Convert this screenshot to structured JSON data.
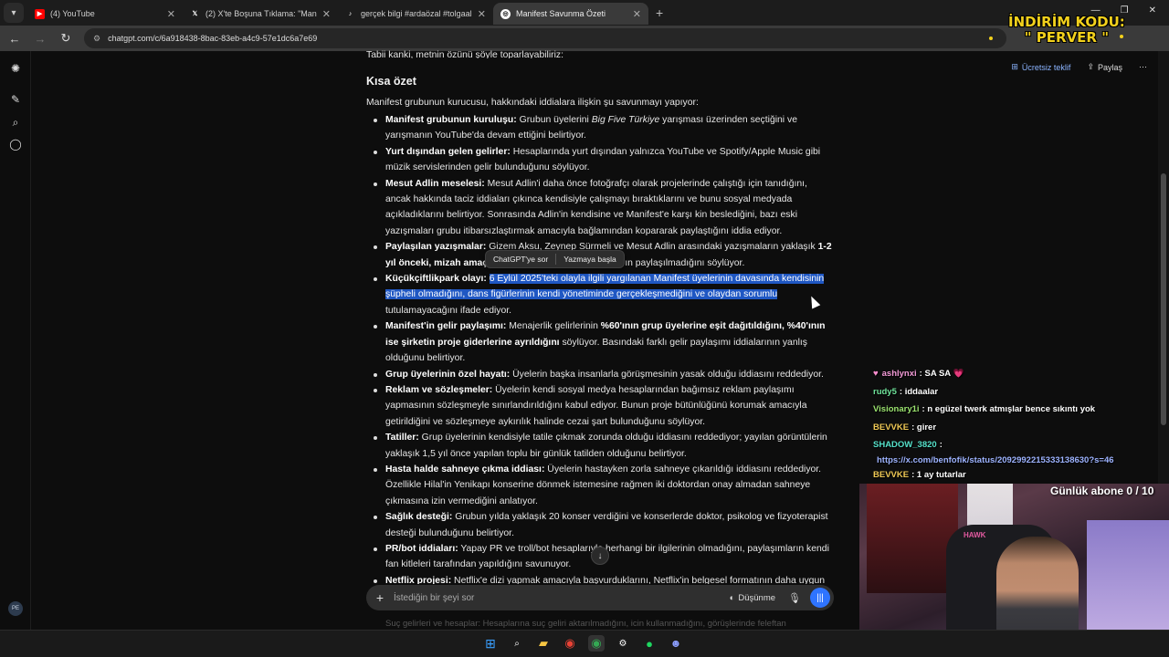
{
  "browser": {
    "tabs": [
      {
        "title": "(4) YouTube",
        "icon": "youtube-icon",
        "active": false
      },
      {
        "title": "(2) X'te Boşuna Tıklama: \"Manif…",
        "icon": "x-icon",
        "active": false
      },
      {
        "title": "gerçek bilgi #ardaözal #tolgaal…",
        "icon": "tiktok-icon",
        "active": false
      },
      {
        "title": "Manifest Savunma Özeti",
        "icon": "chatgpt-icon",
        "active": true
      }
    ],
    "url": "chatgpt.com/c/6a918438-8bac-83eb-a4c9-57e1dc6a7e69",
    "window_controls": {
      "minimize": "—",
      "maximize": "❐",
      "close": "✕"
    }
  },
  "overlay": {
    "promo_line1": "İNDİRİM KODU:",
    "promo_line2": "\" PERVER \""
  },
  "header": {
    "upgrade": "Ücretsiz teklif",
    "share": "Paylaş"
  },
  "sidebar": {
    "user_initials": "PE"
  },
  "conversation": {
    "intro_cut": "Tabii kanki, metnin özünü şöyle toparlayabiliriz:",
    "heading": "Kısa özet",
    "lead": "Manifest grubunun kurucusu, hakkındaki iddialara ilişkin şu savunmayı yapıyor:",
    "bullets": [
      {
        "bold": "Manifest grubunun kuruluşu:",
        "text": " Grubun üyelerini ",
        "italic": "Big Five Türkiye",
        "text2": " yarışması üzerinden seçtiğini ve yarışmanın YouTube'da devam ettiğini belirtiyor."
      },
      {
        "bold": "Yurt dışından gelen gelirler:",
        "text": " Hesaplarında yurt dışından yalnızca YouTube ve Spotify/Apple Music gibi müzik servislerinden gelir bulunduğunu söylüyor."
      },
      {
        "bold": "Mesut Adlin meselesi:",
        "text": " Mesut Adlin'i daha önce fotoğrafçı olarak projelerinde çalıştığı için tanıdığını, ancak hakkında taciz iddiaları çıkınca kendisiyle çalışmayı bıraktıklarını ve bunu sosyal medyada açıkladıklarını belirtiyor. Sonrasında Adlin'in kendisine ve Manifest'e karşı kin beslediğini, bazı eski yazışmaları grubu itibarsızlaştırmak amacıyla bağlamından kopararak paylaştığını iddia ediyor."
      },
      {
        "bold": "Paylaşılan yazışmalar:",
        "text": " Gizem Aksu, Zeynep Sürmeli ve Mesut Adlin arasındaki yazışmaların yaklaşık ",
        "bold2": "1-2 yıl önceki, mizah amaçlı",
        "text2": " yazışmalar olduğunu ve bunların paylaşılmadığını söylüyor."
      },
      {
        "bold": "Küçükçiftlikpark olayı:",
        "sel": "6 Eylül 2025'teki olayla ilgili yargılanan Manifest üyelerinin davasında kendisinin şüpheli olmadığını, dans figürlerinin kendi yönetiminde gerçekleşmediğini ve olaydan sorumlu",
        "text": " tutulamayacağını ifade ediyor."
      },
      {
        "bold": "Manifest'in gelir paylaşımı:",
        "text": " Menajerlik gelirlerinin ",
        "bold2": "%60'ının grup üyelerine eşit dağıtıldığını, %40'ının ise şirketin proje giderlerine ayrıldığını",
        "text2": " söylüyor. Basındaki farklı gelir paylaşımı iddialarının yanlış olduğunu belirtiyor."
      },
      {
        "bold": "Grup üyelerinin özel hayatı:",
        "text": " Üyelerin başka insanlarla görüşmesinin yasak olduğu iddiasını reddediyor."
      },
      {
        "bold": "Reklam ve sözleşmeler:",
        "text": " Üyelerin kendi sosyal medya hesaplarından bağımsız reklam paylaşımı yapmasının sözleşmeyle sınırlandırıldığını kabul ediyor. Bunun proje bütünlüğünü korumak amacıyla getirildiğini ve sözleşmeye aykırılık halinde cezai şart bulunduğunu söylüyor."
      },
      {
        "bold": "Tatiller:",
        "text": " Grup üyelerinin kendisiyle tatile çıkmak zorunda olduğu iddiasını reddediyor; yayılan görüntülerin yaklaşık 1,5 yıl önce yapılan toplu bir günlük tatilden olduğunu belirtiyor."
      },
      {
        "bold": "Hasta halde sahneye çıkma iddiası:",
        "text": " Üyelerin hastayken zorla sahneye çıkarıldığı iddiasını reddediyor. Özellikle Hilal'in Yenikapı konserine dönmek istemesine rağmen iki doktordan onay almadan sahneye çıkmasına izin vermediğini anlatıyor."
      },
      {
        "bold": "Sağlık desteği:",
        "text": " Grubun yılda yaklaşık 20 konser verdiğini ve konserlerde doktor, psikolog ve fizyoterapist desteği bulunduğunu belirtiyor."
      },
      {
        "bold": "PR/bot iddiaları:",
        "text": " Yapay PR ve troll/bot hesaplarıyla herhangi bir ilgilerinin olmadığını, paylaşımların kendi fan kitleleri tarafından yapıldığını savunuyor."
      },
      {
        "bold": "Netflix projesi:",
        "text": " Netflix'e dizi yapmak amacıyla başvurduklarını, Netflix'in belgesel formatının daha uygun"
      }
    ],
    "below_fold": "Suç gelirleri ve hesaplar: Hesaplarına suç geliri aktarılmadığını, icin kullanmadığını, görüşlerinde feleftan"
  },
  "selection_popup": {
    "ask": "ChatGPT'ye sor",
    "write": "Yazmaya başla"
  },
  "composer": {
    "placeholder": "İstediğin bir şeyi sor",
    "think": "Düşünme"
  },
  "stream_chat": [
    {
      "nick": "ashlynxi",
      "color": "#f29ad6",
      "text": "SA  SA 💗",
      "prefix": "♥"
    },
    {
      "nick": "rudy5",
      "color": "#6fe39a",
      "text": "iddaalar"
    },
    {
      "nick": "Visionary1i",
      "color": "#9be36f",
      "text": "n egüzel twerk atmışlar bence sıkıntı yok"
    },
    {
      "nick": "BEVVKE",
      "color": "#f0c955",
      "text": "girer"
    },
    {
      "nick": "SHADOW_3820",
      "color": "#55e0c9",
      "text": ""
    },
    {
      "nick": "",
      "color": "#9db3ff",
      "text": "",
      "link": "https://x.com/benfofik/status/2092992215333138630?s=46"
    },
    {
      "nick": "BEVVKE",
      "color": "#f0c955",
      "text": "1 ay tutarlar"
    }
  ],
  "sub_goal": "Günlük abone 0 / 10",
  "webcam": {
    "chair_brand": "HAWK"
  },
  "colors": {
    "selection": "#1f57c3",
    "accent": "#2f74ff",
    "promo": "#f3d11c"
  }
}
